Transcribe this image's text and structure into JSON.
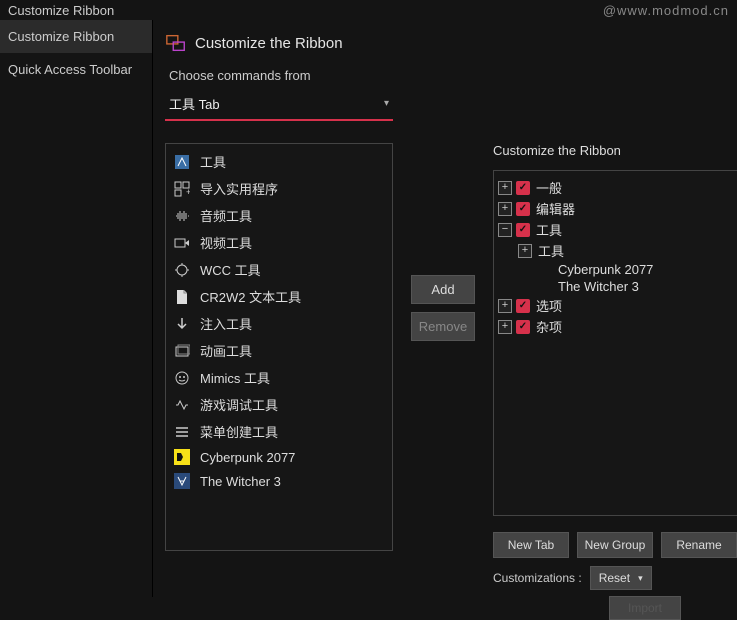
{
  "top": {
    "title": "Customize Ribbon",
    "watermark": "@www.modmod.cn"
  },
  "sidebar": {
    "items": [
      {
        "label": "Customize Ribbon",
        "active": true
      },
      {
        "label": "Quick Access Toolbar",
        "active": false
      }
    ]
  },
  "header": {
    "title": "Customize the Ribbon"
  },
  "choose": {
    "label": "Choose commands from",
    "value": "工具 Tab"
  },
  "commands": [
    {
      "icon": "tool-icon",
      "label": "工具"
    },
    {
      "icon": "import-icon",
      "label": "导入实用程序"
    },
    {
      "icon": "audio-icon",
      "label": "音频工具"
    },
    {
      "icon": "video-icon",
      "label": "视频工具"
    },
    {
      "icon": "wcc-icon",
      "label": "WCC 工具"
    },
    {
      "icon": "file-icon",
      "label": "CR2W2 文本工具"
    },
    {
      "icon": "inject-icon",
      "label": "注入工具"
    },
    {
      "icon": "anim-icon",
      "label": "动画工具"
    },
    {
      "icon": "mimics-icon",
      "label": "Mimics 工具"
    },
    {
      "icon": "debug-icon",
      "label": "游戏调试工具"
    },
    {
      "icon": "menu-icon",
      "label": "菜单创建工具"
    },
    {
      "icon": "cp-icon",
      "label": "Cyberpunk 2077"
    },
    {
      "icon": "tw-icon",
      "label": "The Witcher 3"
    }
  ],
  "mid": {
    "add": "Add",
    "remove": "Remove"
  },
  "right": {
    "title": "Customize the Ribbon",
    "tree": [
      {
        "exp": "+",
        "chk": true,
        "label": "一般",
        "indent": 0
      },
      {
        "exp": "+",
        "chk": true,
        "label": "编辑器",
        "indent": 0
      },
      {
        "exp": "-",
        "chk": true,
        "label": "工具",
        "indent": 0
      },
      {
        "exp": "+",
        "chk": false,
        "label": "工具",
        "indent": 1,
        "nochk": true
      },
      {
        "exp": "",
        "chk": false,
        "label": "Cyberpunk 2077",
        "indent": 2,
        "nochk": true
      },
      {
        "exp": "",
        "chk": false,
        "label": "The Witcher 3",
        "indent": 2,
        "nochk": true
      },
      {
        "exp": "+",
        "chk": true,
        "label": "选项",
        "indent": 0
      },
      {
        "exp": "+",
        "chk": true,
        "label": "杂项",
        "indent": 0
      }
    ]
  },
  "bottom": {
    "newTab": "New Tab",
    "newGroup": "New Group",
    "rename": "Rename",
    "customizations": "Customizations :",
    "reset": "Reset",
    "import": "Import"
  }
}
